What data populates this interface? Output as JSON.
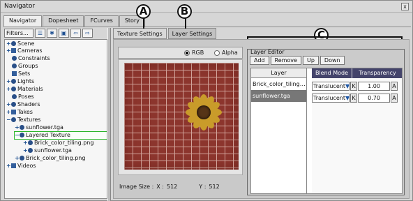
{
  "window": {
    "title": "Navigator",
    "close": "x"
  },
  "main_tabs": [
    {
      "label": "Navigator"
    },
    {
      "label": "Dopesheet"
    },
    {
      "label": "FCurves"
    },
    {
      "label": "Story"
    }
  ],
  "toolbar": {
    "filters": "Filters..."
  },
  "tree": [
    {
      "label": "Scene"
    },
    {
      "label": "Cameras"
    },
    {
      "label": "Constraints"
    },
    {
      "label": "Groups"
    },
    {
      "label": "Sets"
    },
    {
      "label": "Lights"
    },
    {
      "label": "Materials"
    },
    {
      "label": "Poses"
    },
    {
      "label": "Shaders"
    },
    {
      "label": "Takes"
    },
    {
      "label": "Textures"
    },
    {
      "label": "sunflower.tga"
    },
    {
      "label": "Layered Texture"
    },
    {
      "label": "Brick_color_tiling.png"
    },
    {
      "label": "sunflower.tga"
    },
    {
      "label": "Brick_color_tiling.png"
    },
    {
      "label": "Videos"
    }
  ],
  "right_tabs": [
    {
      "label": "Texture Settings"
    },
    {
      "label": "Layer Settings"
    }
  ],
  "callouts": {
    "a": "A",
    "b": "B",
    "c": "C"
  },
  "preview": {
    "rgb": "RGB",
    "alpha": "Alpha",
    "selected_channel": "RGB"
  },
  "image_size": {
    "label": "Image Size :",
    "x_label": "X :",
    "x": "512",
    "y_label": "Y :",
    "y": "512"
  },
  "layer_editor": {
    "title": "Layer Editor",
    "buttons": [
      "Add",
      "Remove",
      "Up",
      "Down"
    ],
    "columns": {
      "layer": "Layer",
      "blend_mode": "Blend Mode",
      "transparency": "Transparency"
    },
    "rows": [
      {
        "layer": "Brick_color_tiling.p...",
        "blend": "Translucent",
        "k": "K",
        "transparency": "1.00",
        "a": "A"
      },
      {
        "layer": "sunflower.tga",
        "blend": "Translucent",
        "k": "K",
        "transparency": "0.70",
        "a": "A"
      }
    ]
  },
  "colors": {
    "selected_outline": "#29b529",
    "accent_blue": "#1f58a6",
    "header": "#44446b",
    "brick": "#8c352d"
  }
}
